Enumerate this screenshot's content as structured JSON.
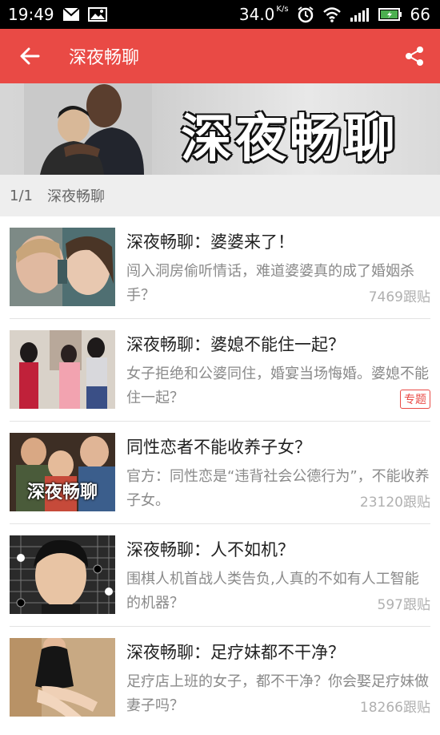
{
  "status_bar": {
    "time": "19:49",
    "net_speed": "34.0",
    "net_speed_unit": "K/s",
    "battery": "66"
  },
  "app_bar": {
    "title": "深夜畅聊"
  },
  "banner": {
    "title": "深夜畅聊"
  },
  "page_indicator": {
    "page": "1/1",
    "label": "深夜畅聊"
  },
  "articles": [
    {
      "title": "深夜畅聊：婆婆来了！",
      "description": "闯入洞房偷听情话，难道婆婆真的成了婚姻杀手？",
      "replies": "7469跟贴"
    },
    {
      "title": "深夜畅聊：婆媳不能住一起？",
      "description": "女子拒绝和公婆同住，婚宴当场悔婚。婆媳不能住一起？",
      "badge": "专题"
    },
    {
      "title": "同性恋者不能收养子女？",
      "description": "官方：同性恋是“违背社会公德行为”，不能收养子女。",
      "replies": "23120跟贴",
      "thumb_caption": "深夜畅聊"
    },
    {
      "title": "深夜畅聊：人不如机？",
      "description": "围棋人机首战人类告负,人真的不如有人工智能的机器？",
      "replies": "597跟贴"
    },
    {
      "title": "深夜畅聊：足疗妹都不干净？",
      "description": "足疗店上班的女子，都不干净？你会娶足疗妹做妻子吗？",
      "replies": "18266跟贴"
    }
  ],
  "colors": {
    "accent": "#e94a45",
    "status_bar": "#000000",
    "battery_fill": "#4caf50"
  }
}
